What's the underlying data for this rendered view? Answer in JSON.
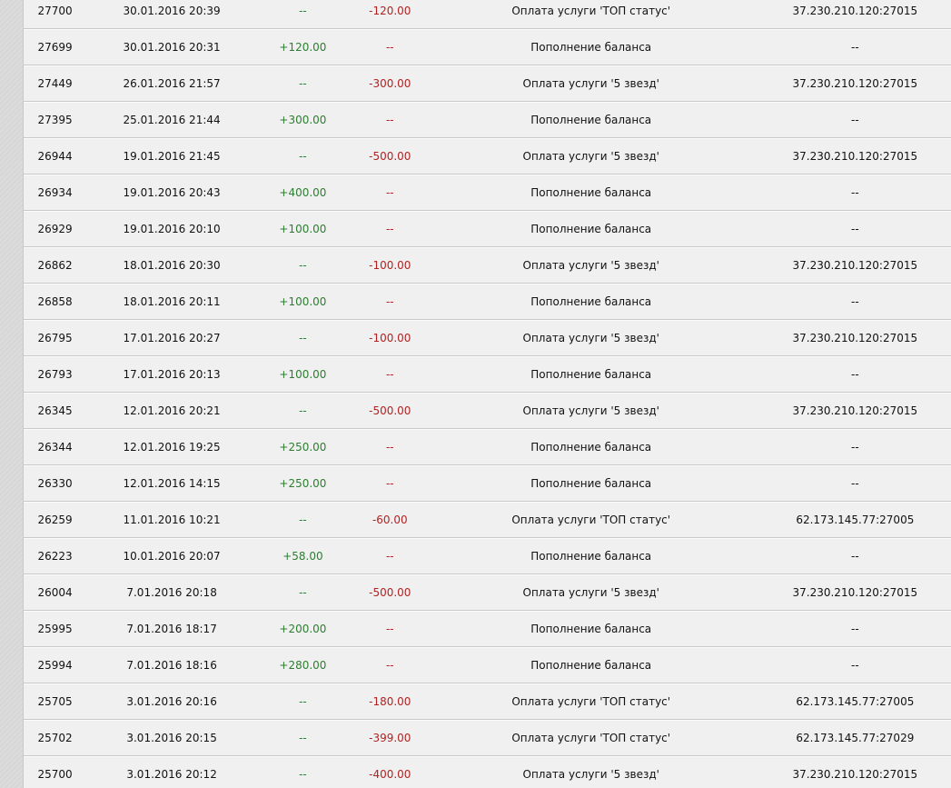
{
  "transactions": [
    {
      "id": "27700",
      "date": "30.01.2016 20:39",
      "credit": "--",
      "debit": "-120.00",
      "description": "Оплата услуги 'ТОП статус'",
      "ip": "37.230.210.120:27015"
    },
    {
      "id": "27699",
      "date": "30.01.2016 20:31",
      "credit": "+120.00",
      "debit": "--",
      "description": "Пополнение баланса",
      "ip": "--"
    },
    {
      "id": "27449",
      "date": "26.01.2016 21:57",
      "credit": "--",
      "debit": "-300.00",
      "description": "Оплата услуги '5 звезд'",
      "ip": "37.230.210.120:27015"
    },
    {
      "id": "27395",
      "date": "25.01.2016 21:44",
      "credit": "+300.00",
      "debit": "--",
      "description": "Пополнение баланса",
      "ip": "--"
    },
    {
      "id": "26944",
      "date": "19.01.2016 21:45",
      "credit": "--",
      "debit": "-500.00",
      "description": "Оплата услуги '5 звезд'",
      "ip": "37.230.210.120:27015"
    },
    {
      "id": "26934",
      "date": "19.01.2016 20:43",
      "credit": "+400.00",
      "debit": "--",
      "description": "Пополнение баланса",
      "ip": "--"
    },
    {
      "id": "26929",
      "date": "19.01.2016 20:10",
      "credit": "+100.00",
      "debit": "--",
      "description": "Пополнение баланса",
      "ip": "--"
    },
    {
      "id": "26862",
      "date": "18.01.2016 20:30",
      "credit": "--",
      "debit": "-100.00",
      "description": "Оплата услуги '5 звезд'",
      "ip": "37.230.210.120:27015"
    },
    {
      "id": "26858",
      "date": "18.01.2016 20:11",
      "credit": "+100.00",
      "debit": "--",
      "description": "Пополнение баланса",
      "ip": "--"
    },
    {
      "id": "26795",
      "date": "17.01.2016 20:27",
      "credit": "--",
      "debit": "-100.00",
      "description": "Оплата услуги '5 звезд'",
      "ip": "37.230.210.120:27015"
    },
    {
      "id": "26793",
      "date": "17.01.2016 20:13",
      "credit": "+100.00",
      "debit": "--",
      "description": "Пополнение баланса",
      "ip": "--"
    },
    {
      "id": "26345",
      "date": "12.01.2016 20:21",
      "credit": "--",
      "debit": "-500.00",
      "description": "Оплата услуги '5 звезд'",
      "ip": "37.230.210.120:27015"
    },
    {
      "id": "26344",
      "date": "12.01.2016 19:25",
      "credit": "+250.00",
      "debit": "--",
      "description": "Пополнение баланса",
      "ip": "--"
    },
    {
      "id": "26330",
      "date": "12.01.2016 14:15",
      "credit": "+250.00",
      "debit": "--",
      "description": "Пополнение баланса",
      "ip": "--"
    },
    {
      "id": "26259",
      "date": "11.01.2016 10:21",
      "credit": "--",
      "debit": "-60.00",
      "description": "Оплата услуги 'ТОП статус'",
      "ip": "62.173.145.77:27005"
    },
    {
      "id": "26223",
      "date": "10.01.2016 20:07",
      "credit": "+58.00",
      "debit": "--",
      "description": "Пополнение баланса",
      "ip": "--"
    },
    {
      "id": "26004",
      "date": "7.01.2016 20:18",
      "credit": "--",
      "debit": "-500.00",
      "description": "Оплата услуги '5 звезд'",
      "ip": "37.230.210.120:27015"
    },
    {
      "id": "25995",
      "date": "7.01.2016 18:17",
      "credit": "+200.00",
      "debit": "--",
      "description": "Пополнение баланса",
      "ip": "--"
    },
    {
      "id": "25994",
      "date": "7.01.2016 18:16",
      "credit": "+280.00",
      "debit": "--",
      "description": "Пополнение баланса",
      "ip": "--"
    },
    {
      "id": "25705",
      "date": "3.01.2016 20:16",
      "credit": "--",
      "debit": "-180.00",
      "description": "Оплата услуги 'ТОП статус'",
      "ip": "62.173.145.77:27005"
    },
    {
      "id": "25702",
      "date": "3.01.2016 20:15",
      "credit": "--",
      "debit": "-399.00",
      "description": "Оплата услуги 'ТОП статус'",
      "ip": "62.173.145.77:27029"
    },
    {
      "id": "25700",
      "date": "3.01.2016 20:12",
      "credit": "--",
      "debit": "-400.00",
      "description": "Оплата услуги '5 звезд'",
      "ip": "37.230.210.120:27015"
    }
  ]
}
